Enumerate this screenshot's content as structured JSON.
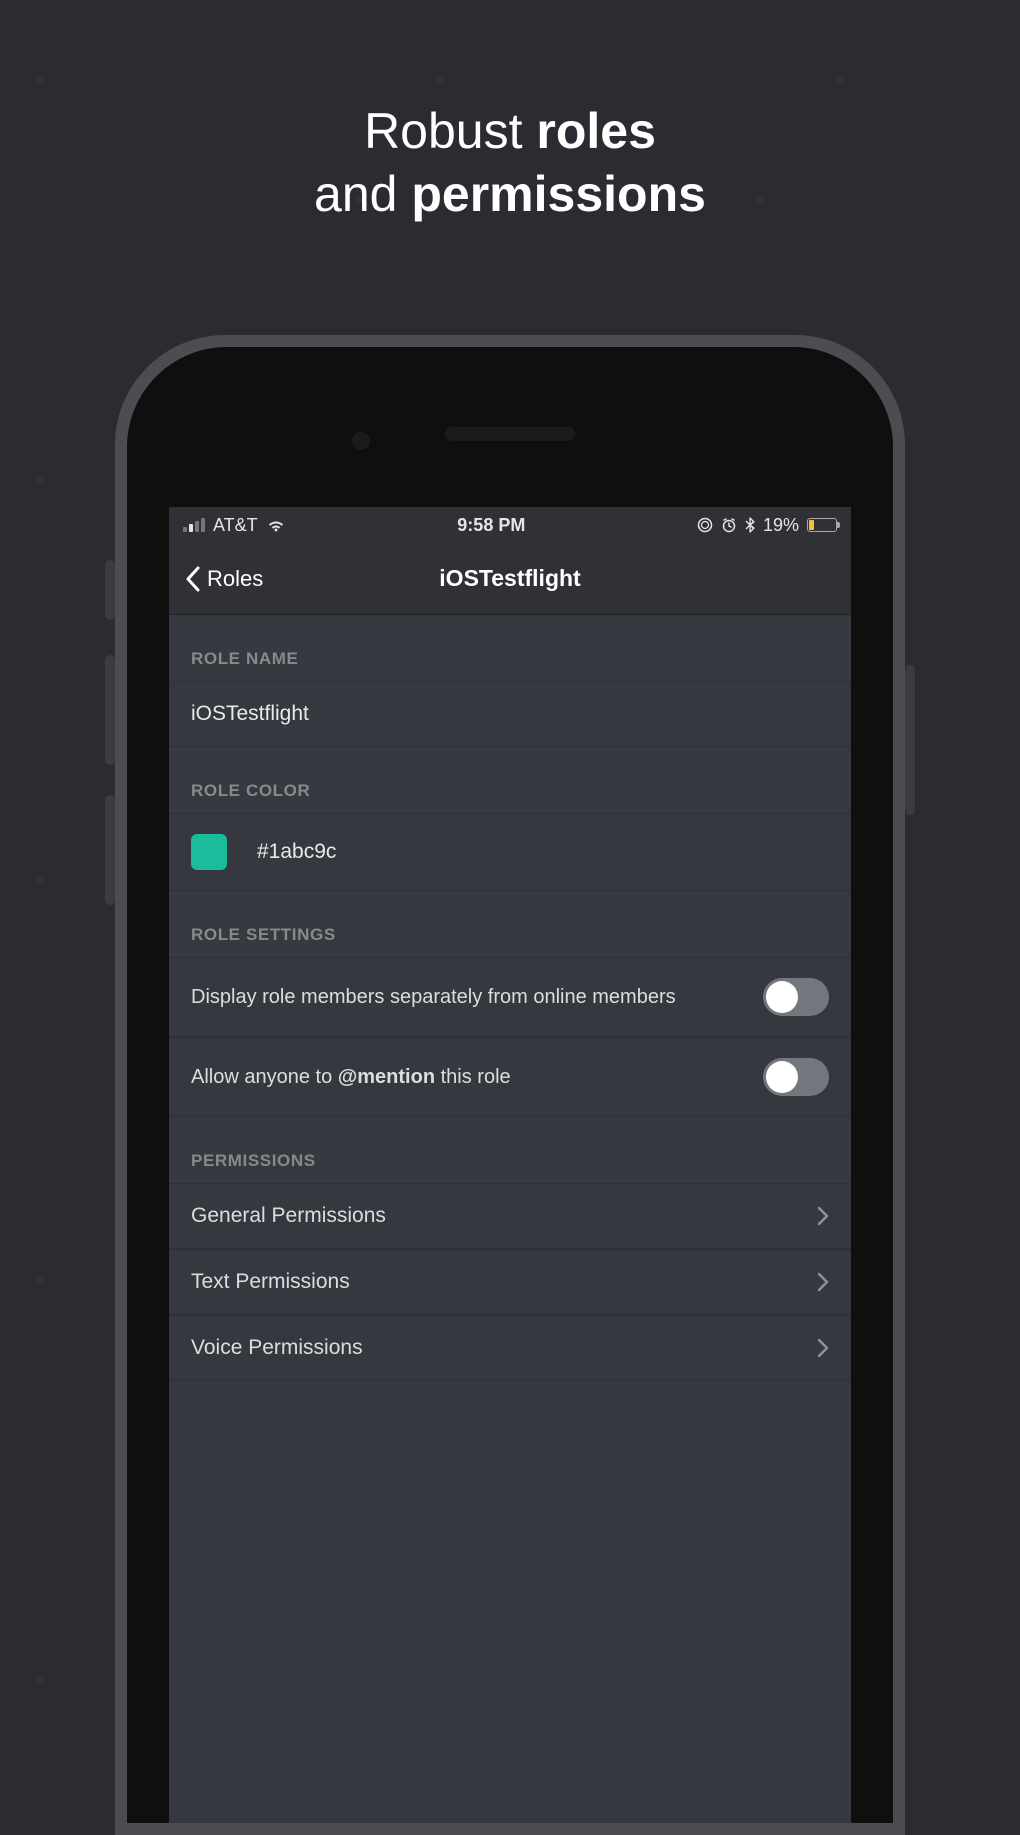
{
  "headline": {
    "line1_pre": "Robust ",
    "line1_bold": "roles",
    "line2_pre": "and ",
    "line2_bold": "permissions"
  },
  "status": {
    "carrier": "AT&T",
    "time": "9:58 PM",
    "battery_pct": "19%"
  },
  "nav": {
    "back_label": "Roles",
    "title": "iOSTestflight"
  },
  "role_name": {
    "header": "ROLE NAME",
    "value": "iOSTestflight"
  },
  "role_color": {
    "header": "ROLE COLOR",
    "hex": "#1abc9c"
  },
  "role_settings": {
    "header": "ROLE SETTINGS",
    "display_separately": "Display role members separately from online members",
    "allow_mention_pre": "Allow anyone to ",
    "allow_mention_bold": "@mention",
    "allow_mention_post": " this role"
  },
  "permissions": {
    "header": "PERMISSIONS",
    "general": "General Permissions",
    "text": "Text Permissions",
    "voice": "Voice Permissions"
  }
}
